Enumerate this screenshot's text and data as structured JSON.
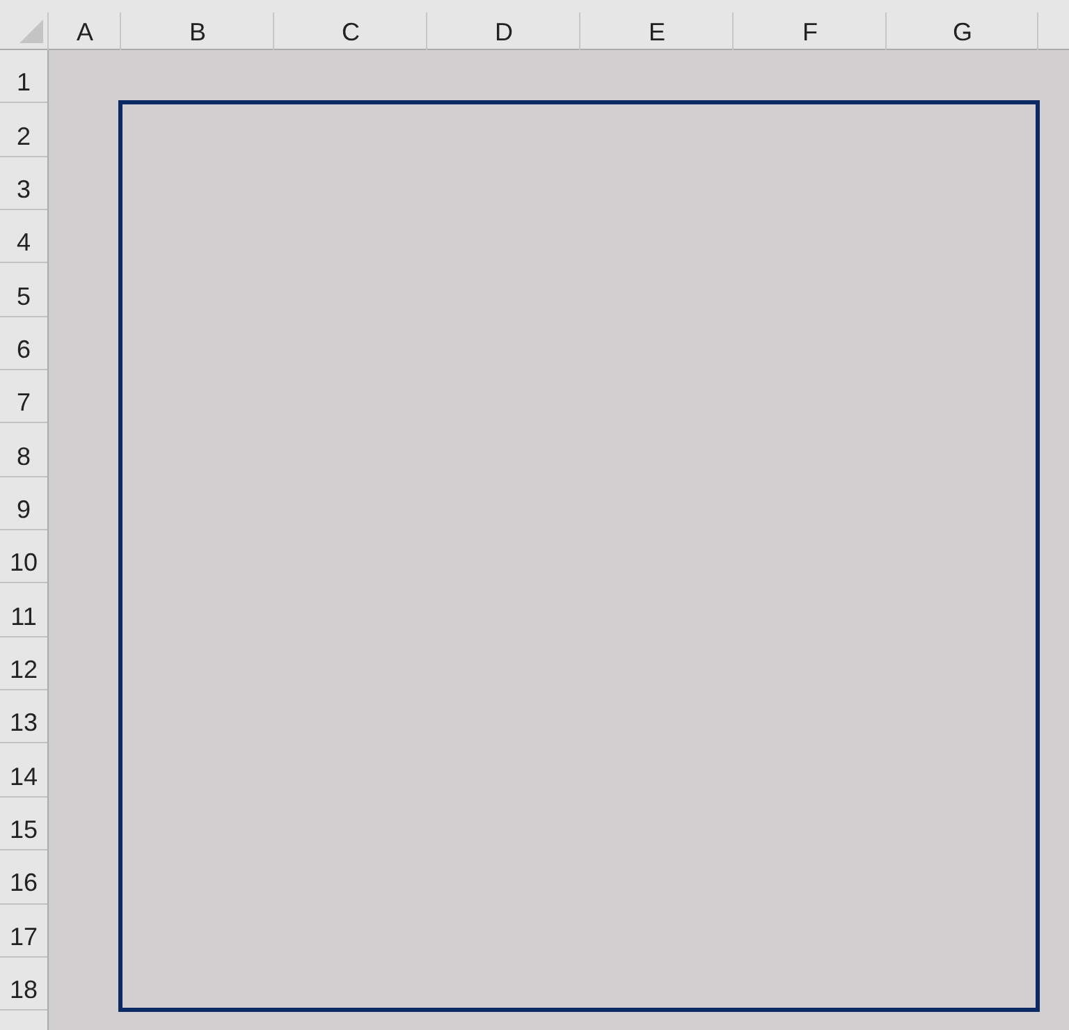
{
  "sheet": {
    "columns": [
      {
        "label": "A"
      },
      {
        "label": "B"
      },
      {
        "label": "C"
      },
      {
        "label": "D"
      },
      {
        "label": "E"
      },
      {
        "label": "F"
      },
      {
        "label": "G"
      }
    ],
    "rows": [
      {
        "label": "1"
      },
      {
        "label": "2"
      },
      {
        "label": "3"
      },
      {
        "label": "4"
      },
      {
        "label": "5"
      },
      {
        "label": "6"
      },
      {
        "label": "7"
      },
      {
        "label": "8"
      },
      {
        "label": "9"
      },
      {
        "label": "10"
      },
      {
        "label": "11"
      },
      {
        "label": "12"
      },
      {
        "label": "13"
      },
      {
        "label": "14"
      },
      {
        "label": "15"
      },
      {
        "label": "16"
      },
      {
        "label": "17"
      },
      {
        "label": "18"
      }
    ],
    "range_border": true
  }
}
